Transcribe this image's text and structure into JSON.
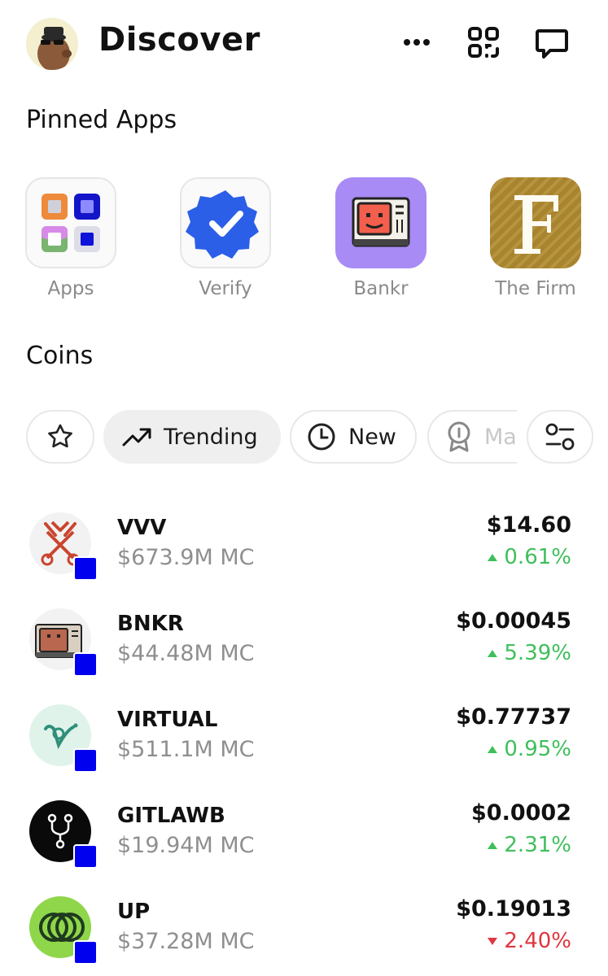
{
  "header": {
    "title": "Discover",
    "icons": [
      "more-icon",
      "scan-icon",
      "chat-icon"
    ]
  },
  "pinned": {
    "title": "Pinned Apps",
    "apps": [
      {
        "label": "Apps",
        "icon": "apps-grid-icon"
      },
      {
        "label": "Verify",
        "icon": "verified-badge-icon"
      },
      {
        "label": "Bankr",
        "icon": "bankr-tv-icon"
      },
      {
        "label": "The Firm",
        "icon": "the-firm-f-icon"
      }
    ]
  },
  "coins": {
    "title": "Coins",
    "filters": [
      {
        "label": "",
        "icon": "star-icon"
      },
      {
        "label": "Trending",
        "icon": "trending-icon",
        "active": true
      },
      {
        "label": "New",
        "icon": "clock-icon"
      },
      {
        "label": "Ma",
        "icon": "medal-icon"
      },
      {
        "label": "",
        "icon": "filter-settings-icon"
      }
    ],
    "list": [
      {
        "symbol": "VVV",
        "mc": "$673.9M MC",
        "price": "$14.60",
        "change": "0.61%",
        "direction": "up"
      },
      {
        "symbol": "BNKR",
        "mc": "$44.48M MC",
        "price": "$0.00045",
        "change": "5.39%",
        "direction": "up"
      },
      {
        "symbol": "VIRTUAL",
        "mc": "$511.1M MC",
        "price": "$0.77737",
        "change": "0.95%",
        "direction": "up"
      },
      {
        "symbol": "GITLAWB",
        "mc": "$19.94M MC",
        "price": "$0.0002",
        "change": "2.31%",
        "direction": "up"
      },
      {
        "symbol": "UP",
        "mc": "$37.28M MC",
        "price": "$0.19013",
        "change": "2.40%",
        "direction": "down"
      }
    ]
  },
  "colors": {
    "up": "#3fbf5c",
    "down": "#e0363f",
    "badge": "#0000ee",
    "bankr_bg": "#a88bf5",
    "firm_bg": "#a8842e",
    "verify_blue": "#2b5fe8"
  }
}
